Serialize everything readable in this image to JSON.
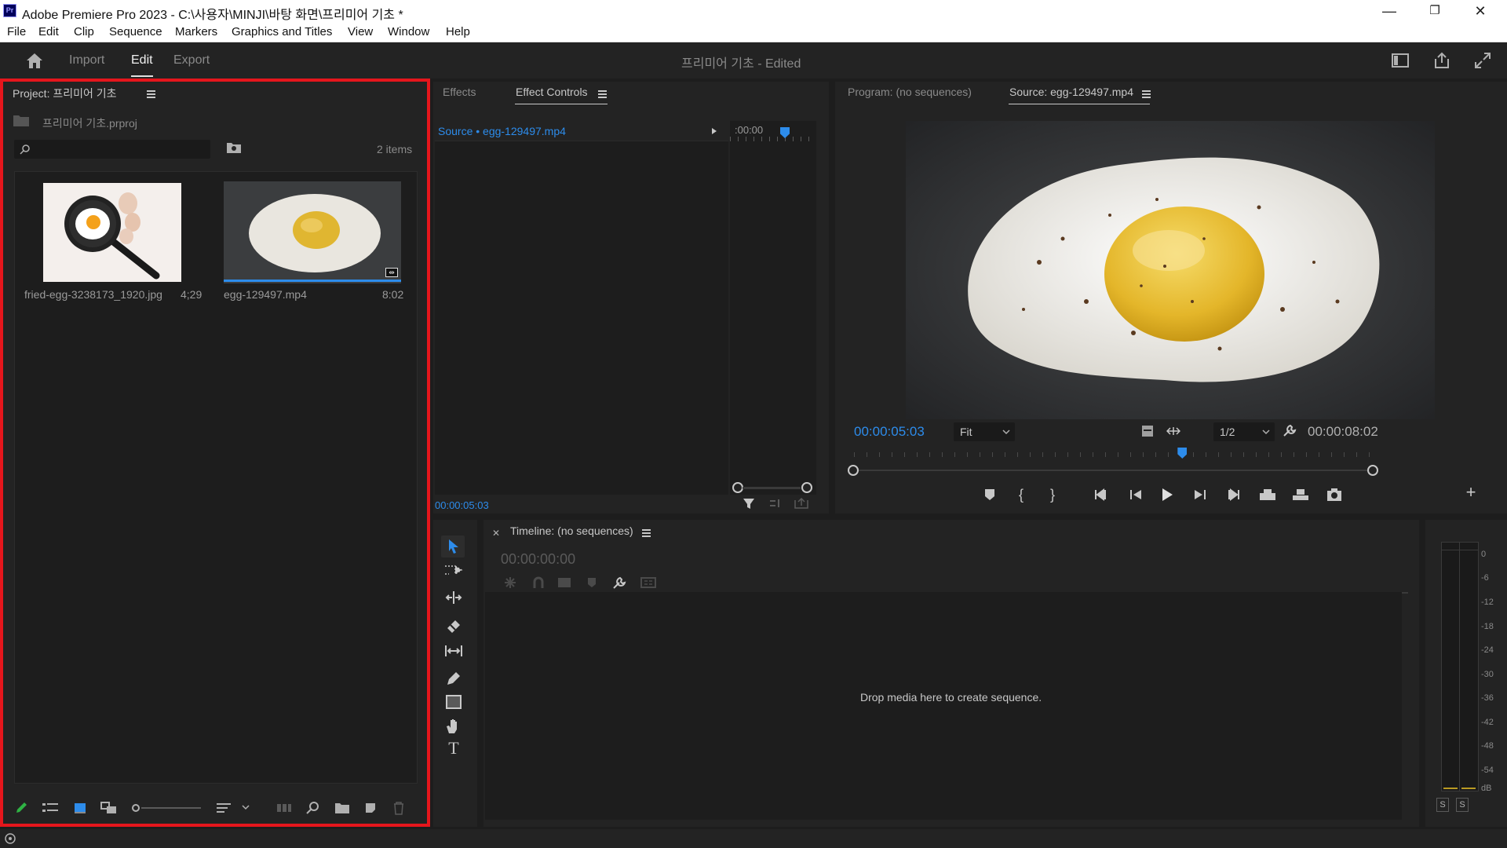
{
  "window": {
    "app_icon_text": "Pr",
    "title": "Adobe Premiere Pro 2023 - C:\\사용자\\MINJI\\바탕 화면\\프리미어 기초 *",
    "minimize": "—",
    "restore": "❐",
    "close": "✕"
  },
  "menu": [
    "File",
    "Edit",
    "Clip",
    "Sequence",
    "Markers",
    "Graphics and Titles",
    "View",
    "Window",
    "Help"
  ],
  "header": {
    "tabs": [
      "Import",
      "Edit",
      "Export"
    ],
    "active_tab": "Edit",
    "project_name": "프리미어 기초",
    "project_status": " - Edited"
  },
  "project_panel": {
    "title": "Project: 프리미어 기초",
    "file": "프리미어 기초.prproj",
    "search_placeholder": "",
    "item_count": "2 items",
    "items": [
      {
        "name": "fried-egg-3238173_1920.jpg",
        "duration": "4;29"
      },
      {
        "name": "egg-129497.mp4",
        "duration": "8:02"
      }
    ]
  },
  "effect_controls": {
    "tabs": [
      "Effects",
      "Effect Controls"
    ],
    "active_tab": "Effect Controls",
    "source": "Source • egg-129497.mp4",
    "ruler_time": ":00:00",
    "timecode": "00:00:05:03"
  },
  "monitor": {
    "tabs": [
      "Program: (no sequences)",
      "Source: egg-129497.mp4"
    ],
    "active_tab": "Source: egg-129497.mp4",
    "timecode_current": "00:00:05:03",
    "zoom": "Fit",
    "resolution": "1/2",
    "timecode_total": "00:00:08:02",
    "playhead_fraction": 0.63
  },
  "timeline": {
    "title": "Timeline: (no sequences)",
    "timecode": "00:00:00:00",
    "empty_message": "Drop media here to create sequence."
  },
  "audio_meter": {
    "labels": [
      "0",
      "-6",
      "-12",
      "-18",
      "-24",
      "-30",
      "-36",
      "-42",
      "-48",
      "-54",
      "dB"
    ],
    "solo_buttons": [
      "S",
      "S"
    ]
  },
  "colors": {
    "accent": "#2d8ceb",
    "highlight": "#e5161c",
    "panel_bg": "#232323",
    "app_bg": "#1d1d1d"
  }
}
